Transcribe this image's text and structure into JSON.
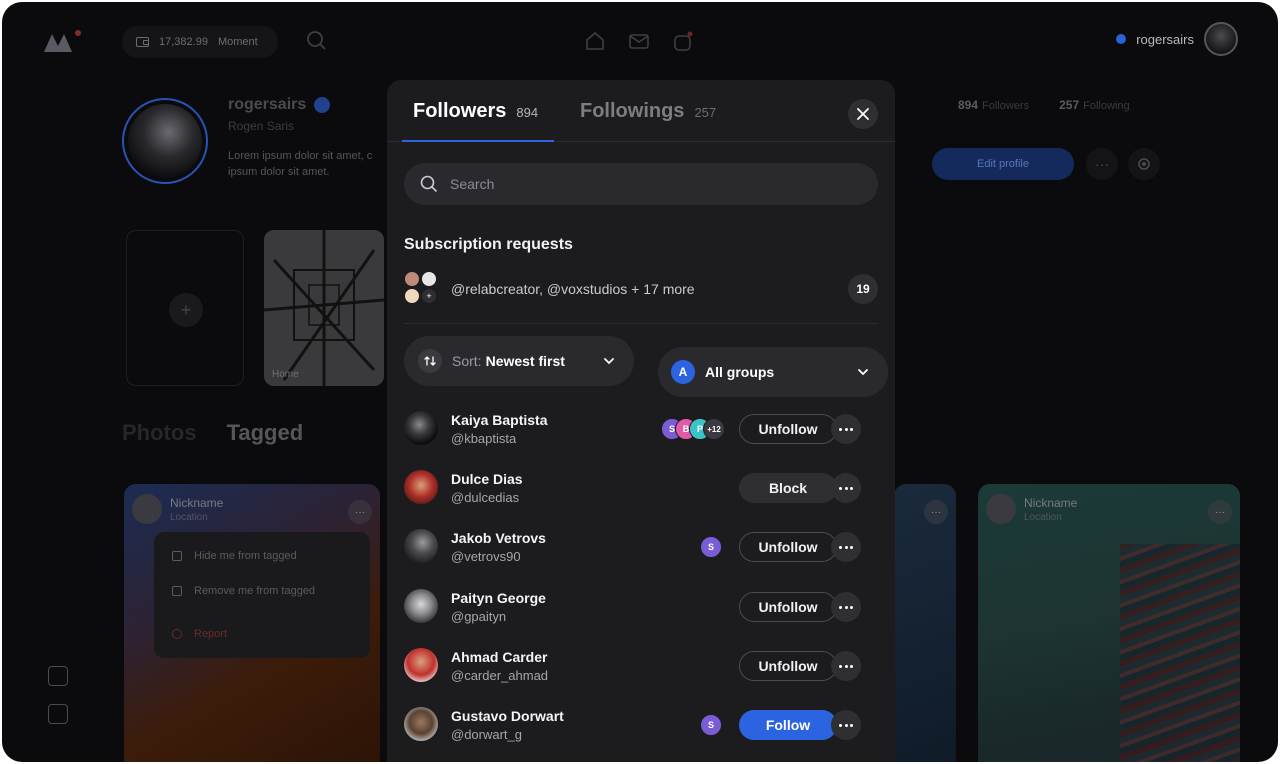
{
  "topbar": {
    "balance_value": "17,382.99",
    "balance_label": "Moment",
    "username": "rogersairs"
  },
  "profile": {
    "name": "rogersairs",
    "fullname": "Rogen Saris",
    "bio": "Lorem ipsum dolor sit amet, c ipsum dolor sit amet.",
    "followers_count": "894",
    "followers_label": "Followers",
    "following_count": "257",
    "following_label": "Following",
    "edit_label": "Edit profile",
    "story_label": "Home",
    "tabs": [
      "Photos",
      "Tagged"
    ]
  },
  "posts": [
    {
      "nickname": "Nickname",
      "location": "Location"
    },
    {
      "nickname": "Nickname",
      "location": "Location"
    }
  ],
  "context_menu": {
    "hide": "Hide me from tagged",
    "remove": "Remove me from tagged",
    "report": "Report"
  },
  "modal": {
    "tabs": [
      {
        "label": "Followers",
        "count": "894"
      },
      {
        "label": "Followings",
        "count": "257"
      }
    ],
    "search_placeholder": "Search",
    "subscription_title": "Subscription requests",
    "subscription_text": "@relabcreator, @voxstudios + 17 more",
    "subscription_count": "19",
    "sort_prefix": "Sort:",
    "sort_value": "Newest first",
    "groups_badge": "A",
    "groups_value": "All groups",
    "users": [
      {
        "name": "Kaiya Baptista",
        "handle": "@kbaptista",
        "groups": [
          "S",
          "B",
          "P",
          "+12"
        ],
        "action": "Unfollow",
        "style": "outline"
      },
      {
        "name": "Dulce Dias",
        "handle": "@dulcedias",
        "groups": [],
        "action": "Block",
        "style": "filled"
      },
      {
        "name": "Jakob Vetrovs",
        "handle": "@vetrovs90",
        "groups": [
          "S"
        ],
        "action": "Unfollow",
        "style": "outline"
      },
      {
        "name": "Paityn George",
        "handle": "@gpaityn",
        "groups": [],
        "action": "Unfollow",
        "style": "outline"
      },
      {
        "name": "Ahmad Carder",
        "handle": "@carder_ahmad",
        "groups": [],
        "action": "Unfollow",
        "style": "outline"
      },
      {
        "name": "Gustavo Dorwart",
        "handle": "@dorwart_g",
        "groups": [
          "S"
        ],
        "action": "Follow",
        "style": "primary"
      }
    ]
  },
  "colors": {
    "accent": "#2b63e0",
    "modal_bg": "#1c1c1f",
    "page_bg": "#0b0b0d",
    "group_s": "#7a5cd6",
    "group_b": "#e05aa8",
    "group_p": "#3cc3c9"
  }
}
